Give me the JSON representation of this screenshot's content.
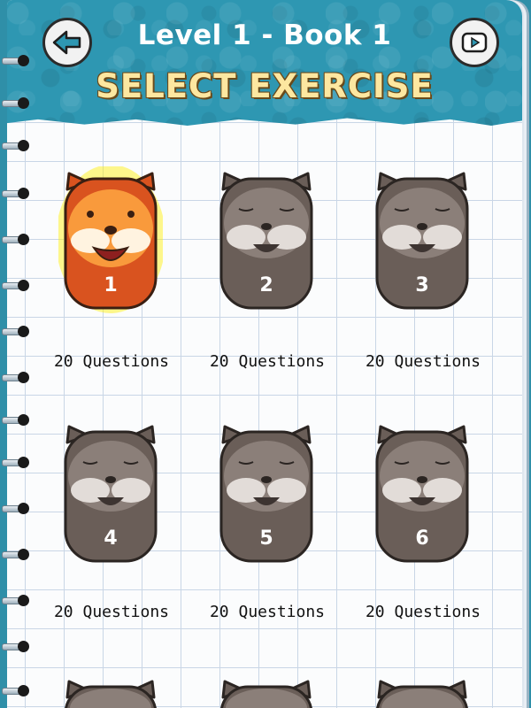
{
  "header": {
    "level_title": "Level 1 - Book 1",
    "screen_title": "SELECT EXERCISE"
  },
  "nav": {
    "back_icon": "back-arrow-icon",
    "video_icon": "video-play-icon"
  },
  "exercises": [
    {
      "number": "1",
      "questions": "20 Questions",
      "unlocked": true
    },
    {
      "number": "2",
      "questions": "20 Questions",
      "unlocked": false
    },
    {
      "number": "3",
      "questions": "20 Questions",
      "unlocked": false
    },
    {
      "number": "4",
      "questions": "20 Questions",
      "unlocked": false
    },
    {
      "number": "5",
      "questions": "20 Questions",
      "unlocked": false
    },
    {
      "number": "6",
      "questions": "20 Questions",
      "unlocked": false
    }
  ],
  "colors": {
    "header": "#2e97b2",
    "title_yellow": "#fde7a0",
    "unlocked": "#d9531f",
    "locked": "#6a5e58"
  }
}
